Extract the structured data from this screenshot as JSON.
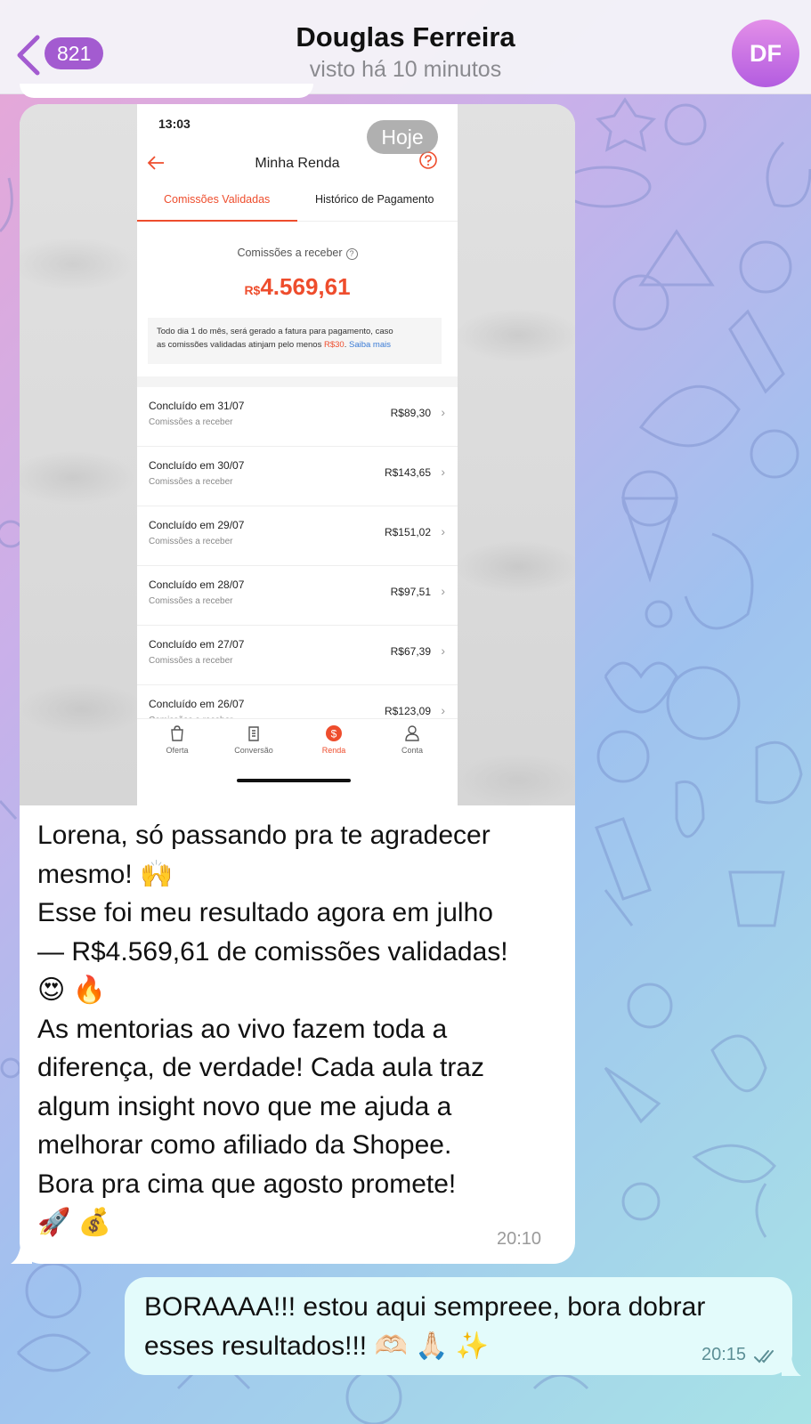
{
  "header": {
    "unread_count": "821",
    "contact_name": "Douglas Ferreira",
    "status": "visto há 10 minutos",
    "avatar_initials": "DF",
    "avatar_color": "#c374e6",
    "badge_color": "#a35bd0"
  },
  "incoming_message": {
    "date_chip": "Hoje",
    "image": {
      "time": "13:03",
      "title": "Minha Renda",
      "tabs": [
        "Comissões Validadas",
        "Histórico de Pagamento"
      ],
      "active_tab": "Comissões Validadas",
      "summary_label": "Comissões a receber",
      "summary_currency": "R$",
      "summary_amount": "4.569,61",
      "note_line1": "Todo dia 1 do mês, será gerado a fatura para pagamento, caso",
      "note_line2_start": "as comissões validadas atinjam pelo menos ",
      "note_min": "R$30",
      "note_link": "Saiba mais",
      "rows": [
        {
          "title": "Concluído em 31/07",
          "subtitle": "Comissões a receber",
          "amount": "R$89,30"
        },
        {
          "title": "Concluído em 30/07",
          "subtitle": "Comissões a receber",
          "amount": "R$143,65"
        },
        {
          "title": "Concluído em 29/07",
          "subtitle": "Comissões a receber",
          "amount": "R$151,02"
        },
        {
          "title": "Concluído em 28/07",
          "subtitle": "Comissões a receber",
          "amount": "R$97,51"
        },
        {
          "title": "Concluído em 27/07",
          "subtitle": "Comissões a receber",
          "amount": "R$67,39"
        },
        {
          "title": "Concluído em 26/07",
          "subtitle": "Comissões a receber",
          "amount": "R$123,09"
        }
      ],
      "nav": [
        "Oferta",
        "Conversão",
        "Renda",
        "Conta"
      ],
      "active_nav": "Renda",
      "accent_color": "#ee4d2d"
    },
    "text": "Lorena, só passando pra te agradecer\nmesmo! 🙌\nEsse foi meu resultado agora em julho\n— R$4.569,61 de comissões validadas!\n😍 🔥\nAs mentorias ao vivo fazem toda a\ndiferença, de verdade! Cada aula traz\nalgum insight novo que me ajuda a\nmelhorar como afiliado da Shopee.\nBora pra cima que agosto promete!\n🚀 💰",
    "time": "20:10"
  },
  "outgoing_message": {
    "text": "BORAAAA!!! estou aqui sempreee, bora dobrar\nesses resultados!!! 🫶🏻 🙏🏻 ✨",
    "time": "20:15",
    "status_icon": "double-check-icon"
  }
}
